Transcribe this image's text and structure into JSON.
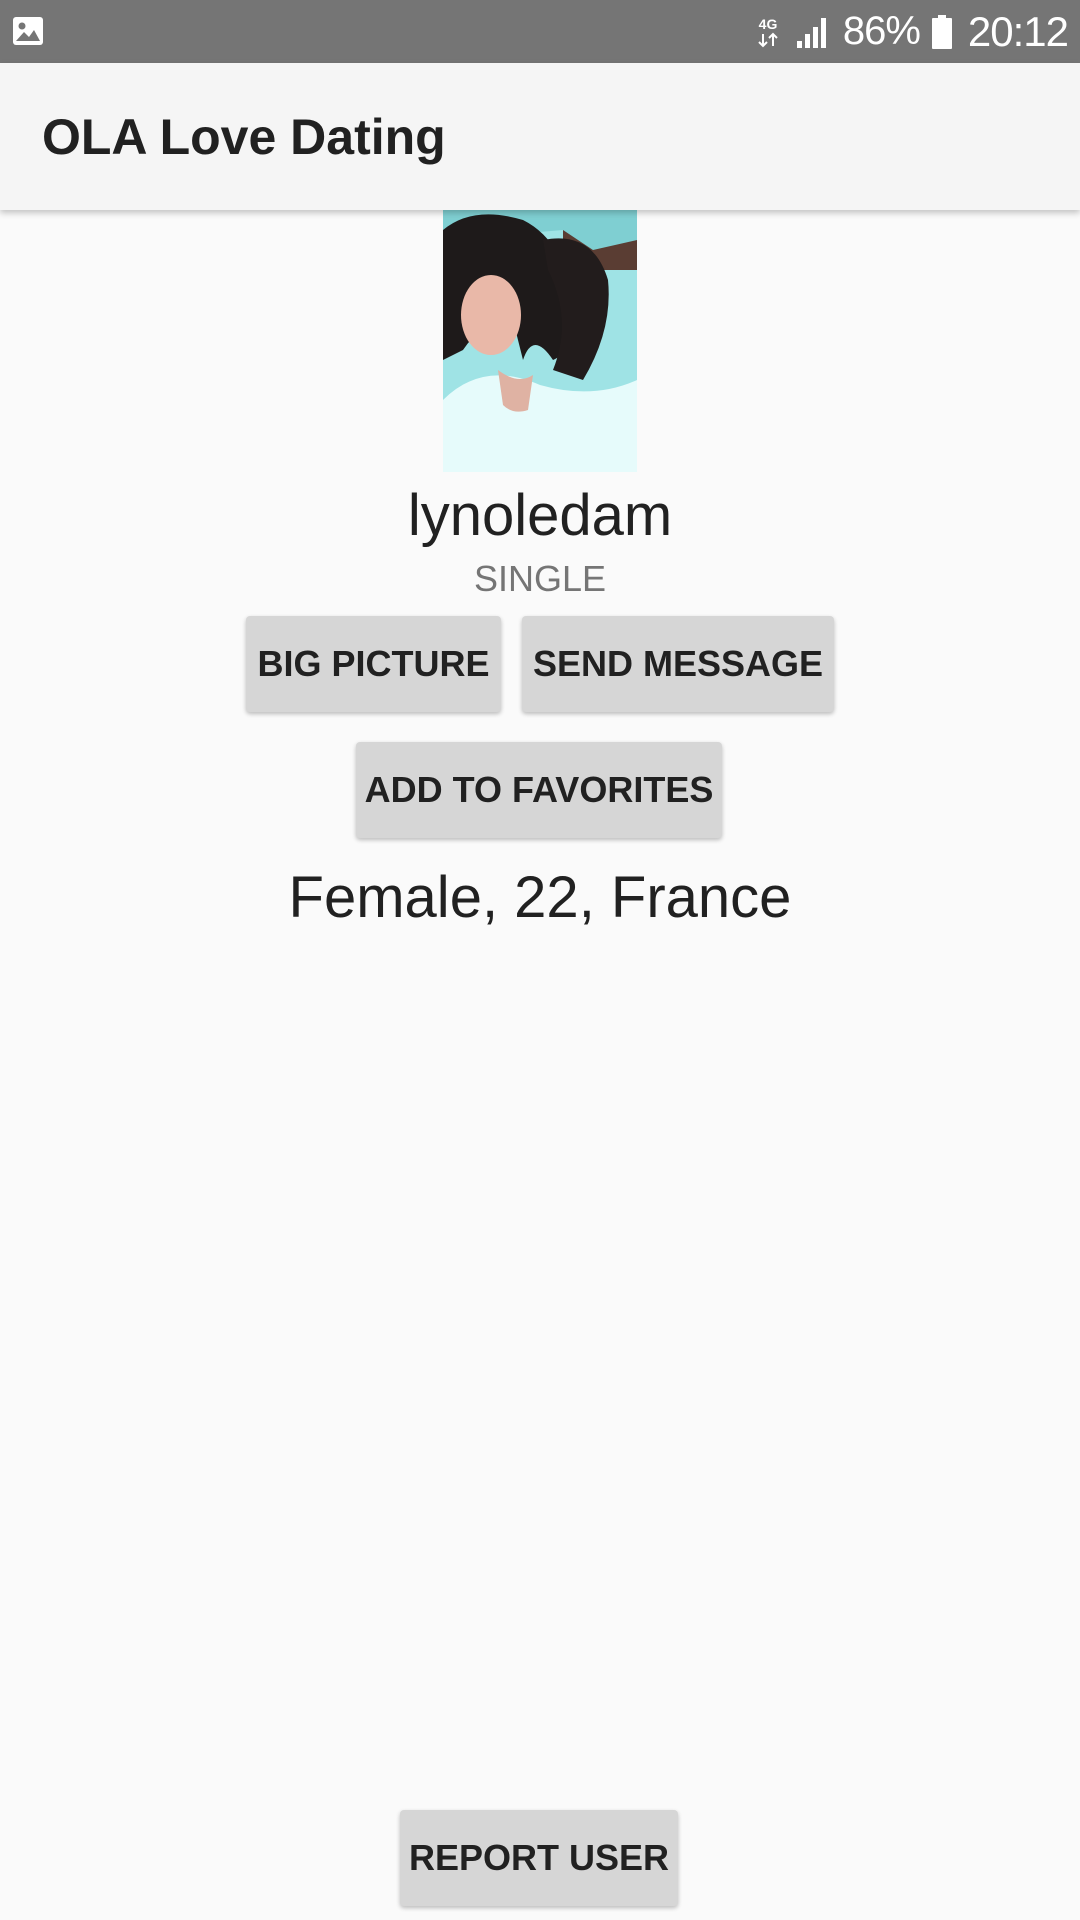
{
  "status_bar": {
    "left_icon": "gallery-icon",
    "network": "4G",
    "signal_icon": "signal-icon",
    "battery_percent": "86%",
    "battery_icon": "battery-icon",
    "time": "20:12"
  },
  "app_bar": {
    "title": "OLA Love Dating"
  },
  "profile": {
    "username": "lynoledam",
    "relationship_status": "SINGLE",
    "details": "Female, 22, France"
  },
  "actions": {
    "big_picture": "BIG PICTURE",
    "send_message": "SEND MESSAGE",
    "add_to_favorites": "ADD TO FAVORITES",
    "report_user": "REPORT USER"
  },
  "colors": {
    "background": "#fafafa",
    "status_bar": "#757575",
    "app_bar": "#f5f5f5",
    "button": "#d6d6d6"
  }
}
